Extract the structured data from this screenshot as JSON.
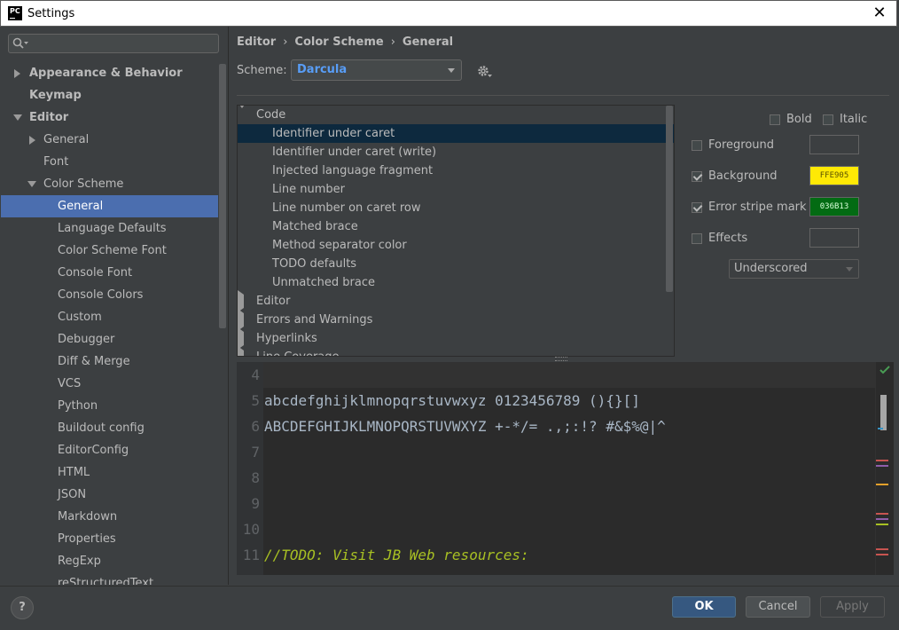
{
  "window": {
    "title": "Settings",
    "app_icon_text": "PC"
  },
  "search": {
    "placeholder": ""
  },
  "sidebar": {
    "items": [
      {
        "label": "Appearance & Behavior"
      },
      {
        "label": "Keymap"
      },
      {
        "label": "Editor"
      },
      {
        "label": "General"
      },
      {
        "label": "Font"
      },
      {
        "label": "Color Scheme"
      },
      {
        "label": "General"
      },
      {
        "label": "Language Defaults"
      },
      {
        "label": "Color Scheme Font"
      },
      {
        "label": "Console Font"
      },
      {
        "label": "Console Colors"
      },
      {
        "label": "Custom"
      },
      {
        "label": "Debugger"
      },
      {
        "label": "Diff & Merge"
      },
      {
        "label": "VCS"
      },
      {
        "label": "Python"
      },
      {
        "label": "Buildout config"
      },
      {
        "label": "EditorConfig"
      },
      {
        "label": "HTML"
      },
      {
        "label": "JSON"
      },
      {
        "label": "Markdown"
      },
      {
        "label": "Properties"
      },
      {
        "label": "RegExp"
      },
      {
        "label": "reStructuredText"
      }
    ]
  },
  "breadcrumb": {
    "parts": [
      "Editor",
      "Color Scheme",
      "General"
    ],
    "separator": "›"
  },
  "scheme": {
    "label": "Scheme:",
    "value": "Darcula"
  },
  "code_tree": {
    "rows": [
      {
        "label": "Code"
      },
      {
        "label": "Identifier under caret"
      },
      {
        "label": "Identifier under caret (write)"
      },
      {
        "label": "Injected language fragment"
      },
      {
        "label": "Line number"
      },
      {
        "label": "Line number on caret row"
      },
      {
        "label": "Matched brace"
      },
      {
        "label": "Method separator color"
      },
      {
        "label": "TODO defaults"
      },
      {
        "label": "Unmatched brace"
      },
      {
        "label": "Editor"
      },
      {
        "label": "Errors and Warnings"
      },
      {
        "label": "Hyperlinks"
      },
      {
        "label": "Line Coverage"
      }
    ]
  },
  "properties": {
    "bold": {
      "label": "Bold",
      "checked": false
    },
    "italic": {
      "label": "Italic",
      "checked": false
    },
    "foreground": {
      "label": "Foreground",
      "checked": false,
      "color": ""
    },
    "background": {
      "label": "Background",
      "checked": true,
      "color": "FFE905",
      "hex": "#ffe905"
    },
    "error_stripe": {
      "label": "Error stripe mark",
      "checked": true,
      "color": "036B13",
      "hex": "#036b13"
    },
    "effects": {
      "label": "Effects",
      "checked": false,
      "type": "Underscored"
    }
  },
  "preview": {
    "lines": [
      {
        "num": "4",
        "text": ""
      },
      {
        "num": "5",
        "text": "abcdefghijklmnopqrstuvwxyz 0123456789 (){}[]"
      },
      {
        "num": "6",
        "text": "ABCDEFGHIJKLMNOPQRSTUVWXYZ +-*/= .,;:!? #&$%@|^"
      },
      {
        "num": "7",
        "text": ""
      },
      {
        "num": "8",
        "text": ""
      },
      {
        "num": "9",
        "text": ""
      },
      {
        "num": "10",
        "text": ""
      },
      {
        "num": "11",
        "text": "//TODO: Visit JB Web resources:"
      }
    ]
  },
  "footer": {
    "help": "?",
    "ok": "OK",
    "cancel": "Cancel",
    "apply": "Apply"
  },
  "colors": {
    "accent": "#4b6eaf",
    "link": "#589df6",
    "todo": "#a8c023"
  }
}
